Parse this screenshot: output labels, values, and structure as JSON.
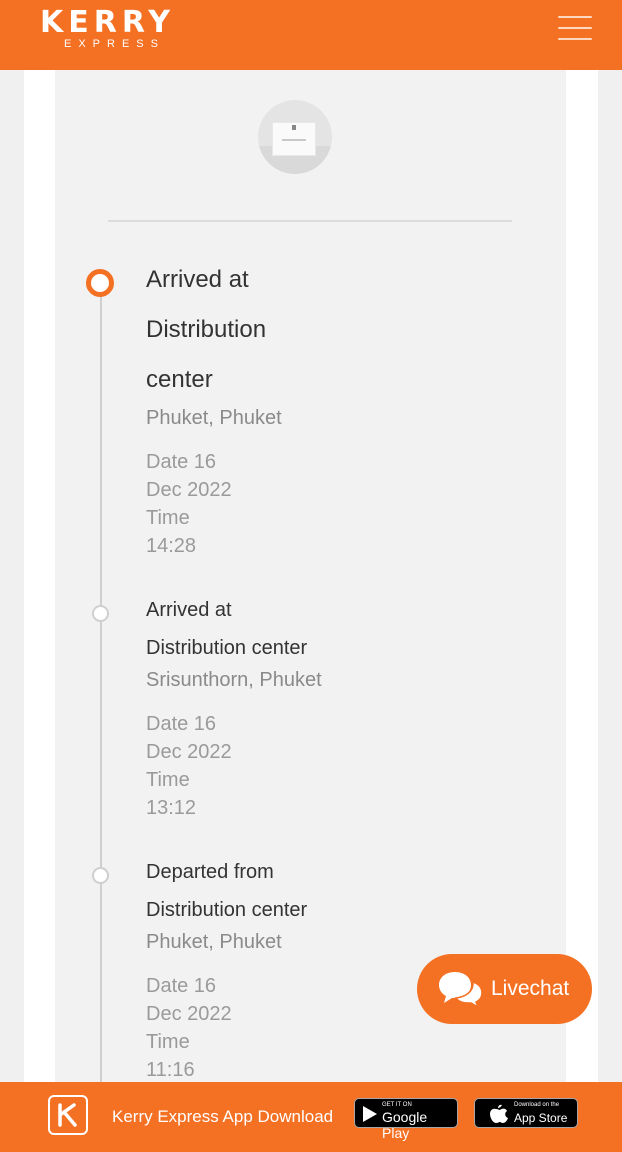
{
  "header": {
    "logo_main": "KERRY",
    "logo_sub": "EXPRESS",
    "menu_icon": "hamburger-menu-icon"
  },
  "parcel": {
    "image_icon": "parcel-box-icon"
  },
  "timeline": {
    "events": [
      {
        "title_lines": [
          "Arrived at",
          "Distribution",
          "center"
        ],
        "location": "Phuket, Phuket",
        "date_lines": [
          "Date 16",
          "Dec 2022",
          "Time",
          "14:28"
        ],
        "status": "current"
      },
      {
        "title_lines": [
          "Arrived at",
          "Distribution center"
        ],
        "location": "Srisunthorn, Phuket",
        "date_lines": [
          "Date 16",
          "Dec 2022",
          "Time",
          "13:12"
        ],
        "status": "past"
      },
      {
        "title_lines": [
          "Departed from",
          "Distribution center"
        ],
        "location": "Phuket, Phuket",
        "date_lines": [
          "Date 16",
          "Dec 2022",
          "Time",
          "11:16"
        ],
        "status": "past"
      }
    ]
  },
  "livechat": {
    "label": "Livechat",
    "icon": "chat-bubbles-icon"
  },
  "footer": {
    "label": "Kerry Express App Download",
    "app_icon": "kerry-k-logo-icon",
    "google_play": {
      "small": "GET IT ON",
      "big": "Google Play"
    },
    "app_store": {
      "small": "Download on the",
      "big": "App Store"
    }
  },
  "colors": {
    "brand_orange": "#f47023",
    "content_bg": "#f2f2f2",
    "timeline_gray": "#cfcfcf"
  }
}
